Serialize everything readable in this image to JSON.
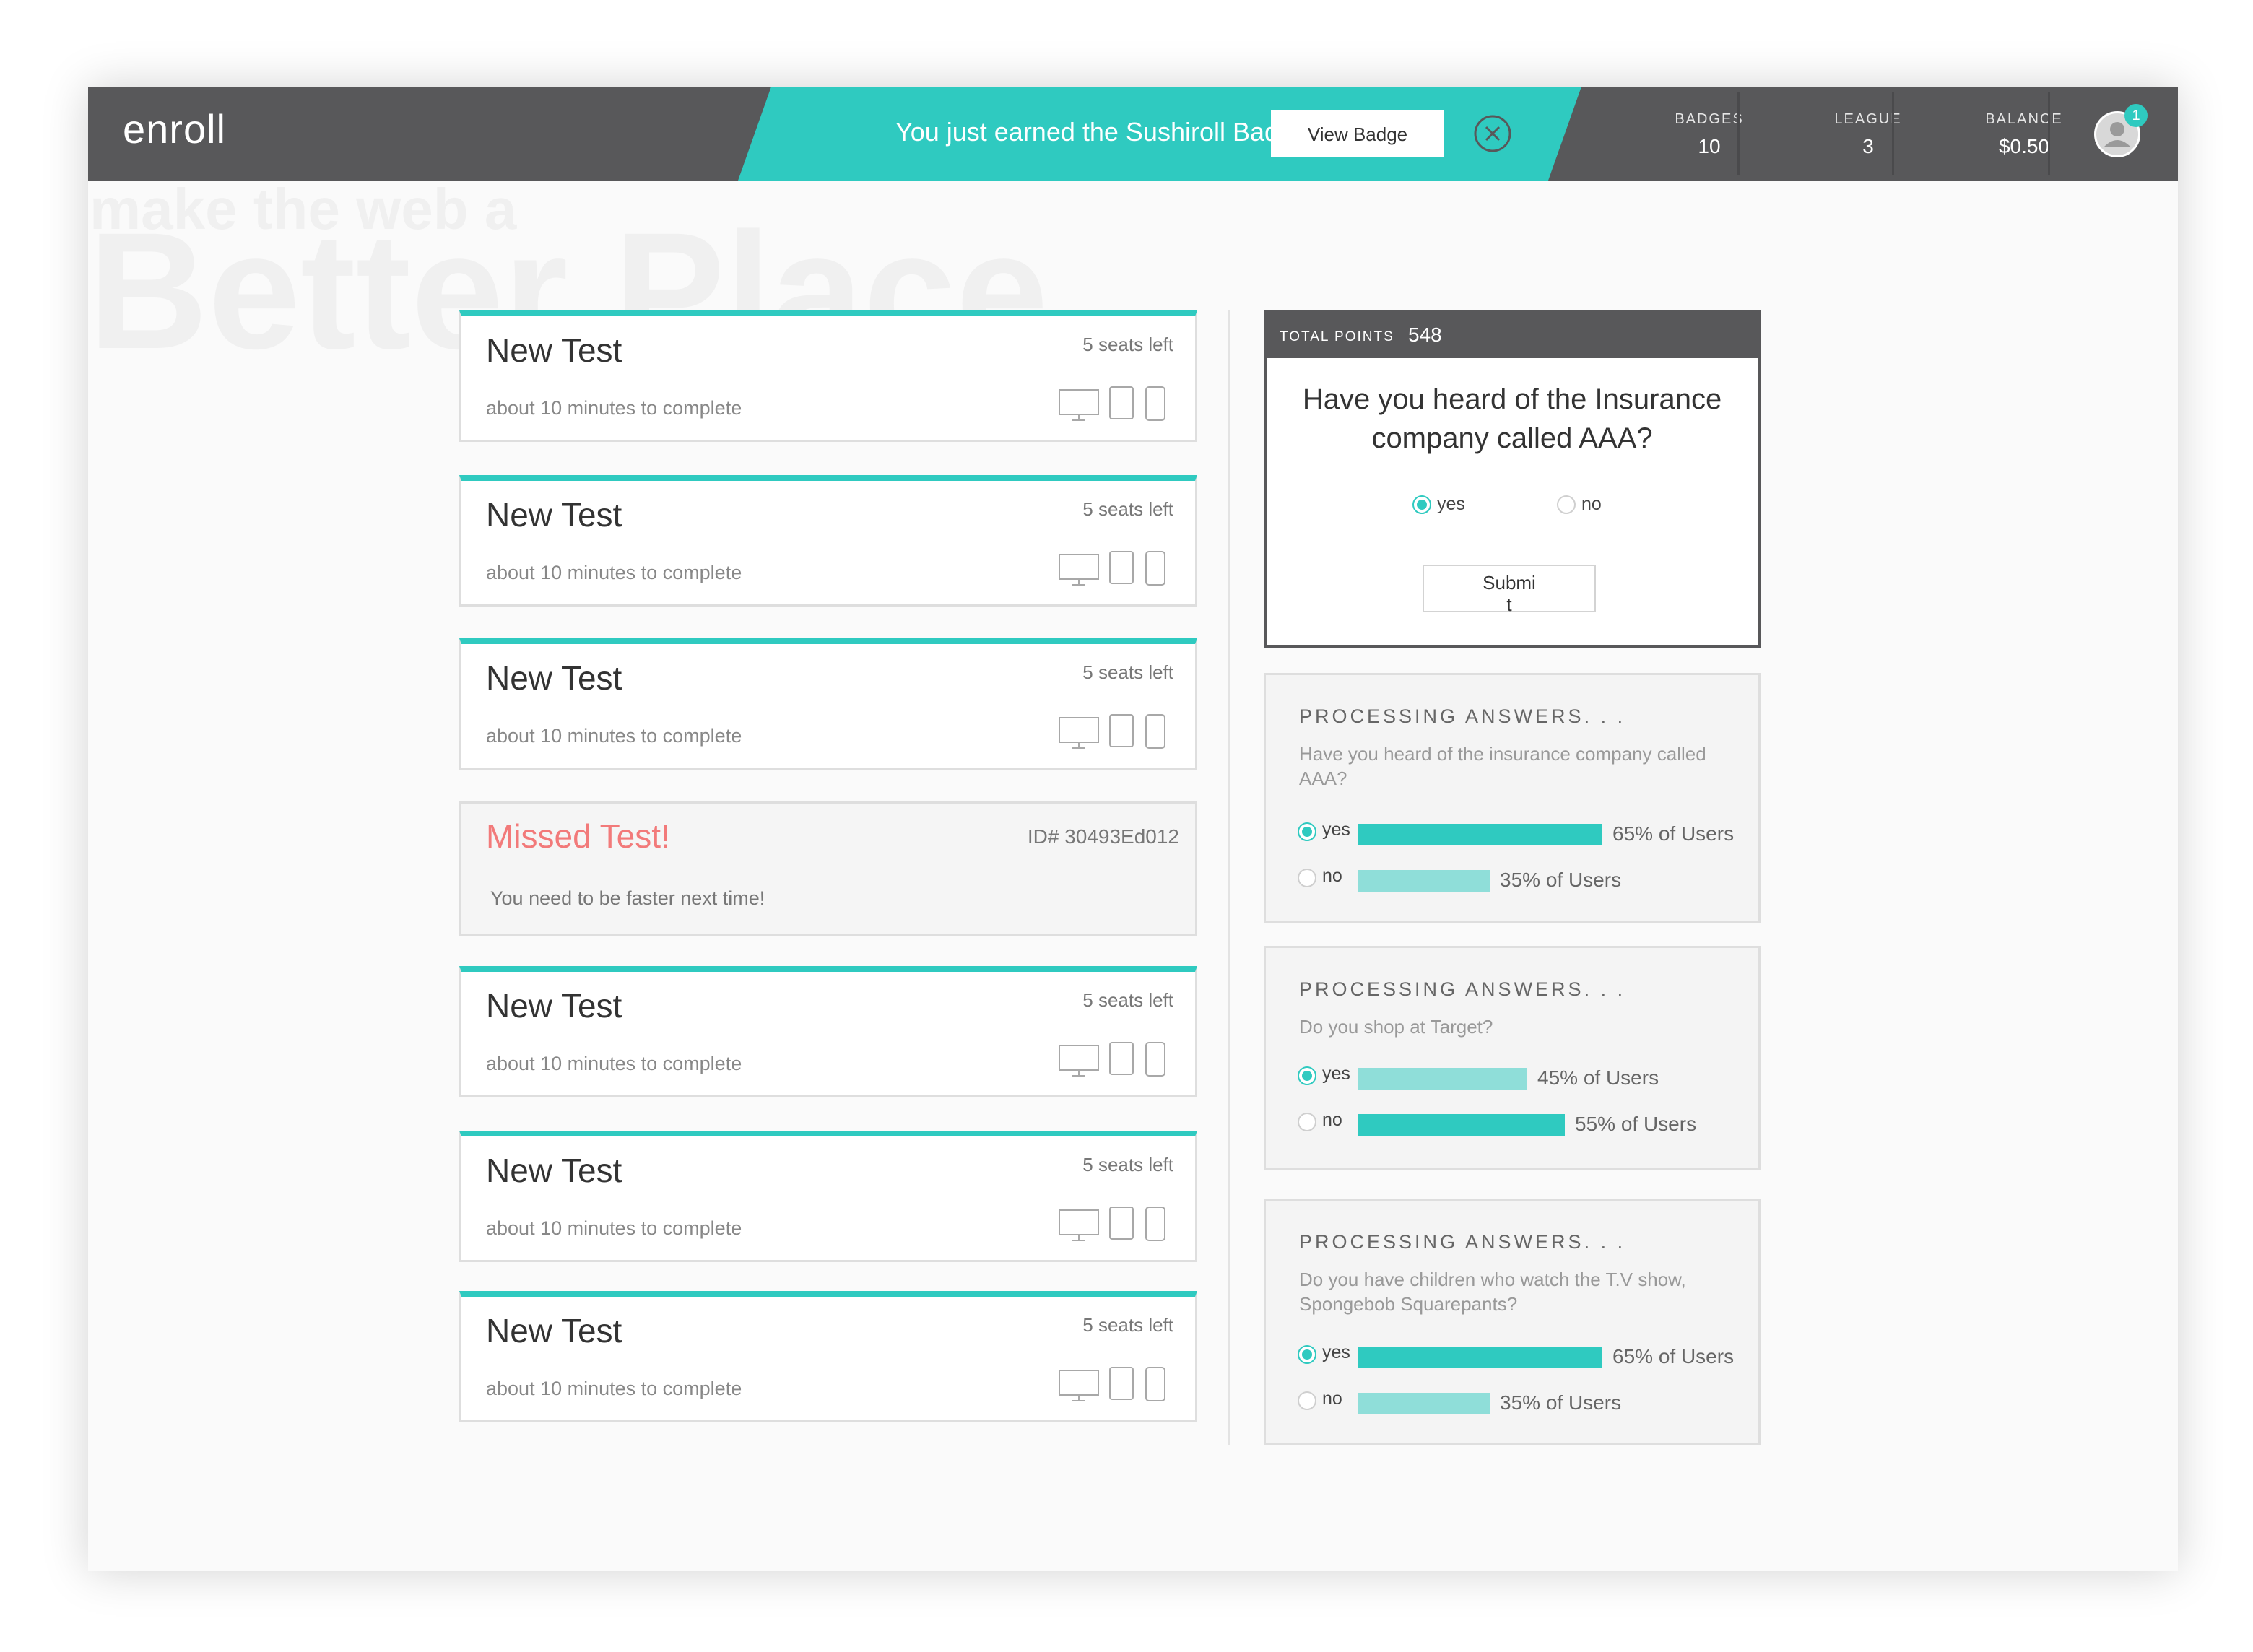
{
  "header": {
    "logo": "enroll",
    "banner_text": "You just earned the Sushiroll Badge!",
    "view_badge_label": "View Badge",
    "stats": [
      {
        "label": "BADGES",
        "value": "10"
      },
      {
        "label": "LEAGUE",
        "value": "3"
      },
      {
        "label": "BALANCE",
        "value": "$0.50"
      }
    ],
    "notification_count": "1"
  },
  "watermark": {
    "line1": "make the web a",
    "line2": "Better Place"
  },
  "tests": [
    {
      "title": "New Test",
      "seats": "5 seats left",
      "duration": "about 10 minutes to complete"
    },
    {
      "title": "New Test",
      "seats": "5 seats left",
      "duration": "about 10 minutes to complete"
    },
    {
      "title": "New Test",
      "seats": "5 seats left",
      "duration": "about 10 minutes to complete"
    },
    {
      "title": "New Test",
      "seats": "5 seats left",
      "duration": "about 10 minutes to complete"
    },
    {
      "title": "New Test",
      "seats": "5 seats left",
      "duration": "about 10 minutes to complete"
    },
    {
      "title": "New Test",
      "seats": "5 seats left",
      "duration": "about 10 minutes to complete"
    }
  ],
  "missed": {
    "title": "Missed Test!",
    "id": "ID# 30493Ed012",
    "message": "You need to be faster next time!"
  },
  "question": {
    "points_label": "TOTAL POINTS",
    "points": "548",
    "text": "Have you heard of the Insurance company called AAA?",
    "options": [
      "yes",
      "no"
    ],
    "selected": "yes",
    "submit_label": "Submit"
  },
  "results": [
    {
      "title": "PROCESSING ANSWERS. . .",
      "question": "Have you heard of the insurance company called AAA?",
      "answers": [
        {
          "label": "yes",
          "pct": 65,
          "text": "65% of Users",
          "selected": true
        },
        {
          "label": "no",
          "pct": 35,
          "text": "35% of Users",
          "selected": false
        }
      ]
    },
    {
      "title": "PROCESSING ANSWERS. . .",
      "question": "Do you shop at Target?",
      "answers": [
        {
          "label": "yes",
          "pct": 45,
          "text": "45% of Users",
          "selected": true
        },
        {
          "label": "no",
          "pct": 55,
          "text": "55% of Users",
          "selected": false
        }
      ]
    },
    {
      "title": "PROCESSING ANSWERS. . .",
      "question": "Do you have children who watch the T.V show, Spongebob Squarepants?",
      "answers": [
        {
          "label": "yes",
          "pct": 65,
          "text": "65% of Users",
          "selected": true
        },
        {
          "label": "no",
          "pct": 35,
          "text": "35% of Users",
          "selected": false
        }
      ]
    }
  ],
  "colors": {
    "accent": "#2fcac0",
    "accent_light": "#8fded9",
    "missed": "#f27a7a",
    "header": "#58585a"
  }
}
